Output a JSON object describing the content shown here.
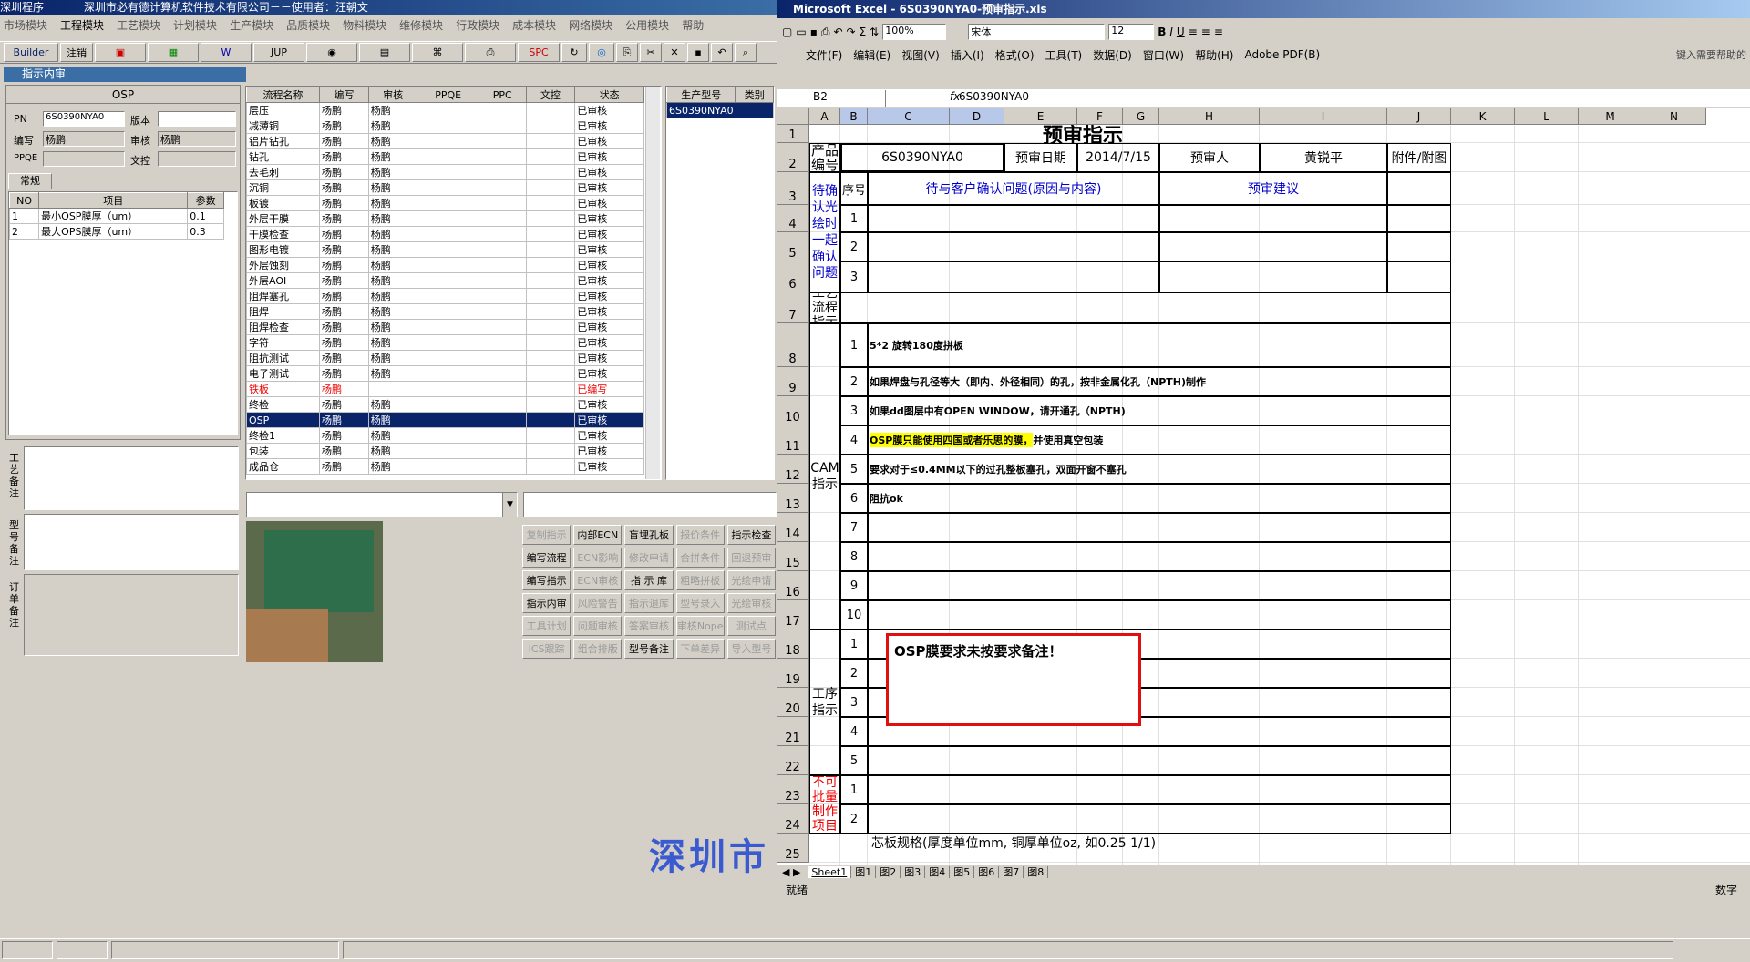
{
  "left": {
    "title": "深圳程序",
    "company": "深圳市必有德计算机软件技术有限公司－－使用者：汪朝文",
    "menu": [
      "市场模块",
      "工程模块",
      "工艺模块",
      "计划模块",
      "生产模块",
      "品质模块",
      "物料模块",
      "维修模块",
      "行政模块",
      "成本模块",
      "网络模块",
      "公用模块",
      "帮助"
    ],
    "toolbar": [
      "Builder",
      "注销",
      "JUP",
      "SPC"
    ],
    "subtitle": "指示内审",
    "form": {
      "header": "OSP",
      "pn_label": "PN",
      "pn": "6S0390NYA0",
      "ver_label": "版本",
      "writer_label": "编写",
      "writer": "杨鹏",
      "checker_label": "审核",
      "checker": "杨鹏",
      "ppqe_label": "PPQE",
      "doc_label": "文控",
      "tab": "常规"
    },
    "params": {
      "headers": [
        "NO",
        "项目",
        "参数"
      ],
      "rows": [
        [
          "1",
          "最小OSP膜厚（um）",
          "0.1"
        ],
        [
          "2",
          "最大OPS膜厚（um）",
          "0.3"
        ]
      ]
    },
    "side_labels": [
      "工艺备注",
      "型号备注",
      "订单备注"
    ],
    "flow": {
      "headers": [
        "流程名称",
        "编写",
        "审核",
        "PPQE",
        "PPC",
        "文控",
        "状态"
      ],
      "rows": [
        [
          "层压",
          "杨鹏",
          "杨鹏",
          "",
          "",
          "",
          "已审核"
        ],
        [
          "减薄铜",
          "杨鹏",
          "杨鹏",
          "",
          "",
          "",
          "已审核"
        ],
        [
          "铝片钻孔",
          "杨鹏",
          "杨鹏",
          "",
          "",
          "",
          "已审核"
        ],
        [
          "钻孔",
          "杨鹏",
          "杨鹏",
          "",
          "",
          "",
          "已审核"
        ],
        [
          "去毛刺",
          "杨鹏",
          "杨鹏",
          "",
          "",
          "",
          "已审核"
        ],
        [
          "沉铜",
          "杨鹏",
          "杨鹏",
          "",
          "",
          "",
          "已审核"
        ],
        [
          "板镀",
          "杨鹏",
          "杨鹏",
          "",
          "",
          "",
          "已审核"
        ],
        [
          "外层干膜",
          "杨鹏",
          "杨鹏",
          "",
          "",
          "",
          "已审核"
        ],
        [
          "干膜检查",
          "杨鹏",
          "杨鹏",
          "",
          "",
          "",
          "已审核"
        ],
        [
          "图形电镀",
          "杨鹏",
          "杨鹏",
          "",
          "",
          "",
          "已审核"
        ],
        [
          "外层蚀刻",
          "杨鹏",
          "杨鹏",
          "",
          "",
          "",
          "已审核"
        ],
        [
          "外层AOI",
          "杨鹏",
          "杨鹏",
          "",
          "",
          "",
          "已审核"
        ],
        [
          "阻焊塞孔",
          "杨鹏",
          "杨鹏",
          "",
          "",
          "",
          "已审核"
        ],
        [
          "阻焊",
          "杨鹏",
          "杨鹏",
          "",
          "",
          "",
          "已审核"
        ],
        [
          "阻焊检查",
          "杨鹏",
          "杨鹏",
          "",
          "",
          "",
          "已审核"
        ],
        [
          "字符",
          "杨鹏",
          "杨鹏",
          "",
          "",
          "",
          "已审核"
        ],
        [
          "阻抗测试",
          "杨鹏",
          "杨鹏",
          "",
          "",
          "",
          "已审核"
        ],
        [
          "电子测试",
          "杨鹏",
          "杨鹏",
          "",
          "",
          "",
          "已审核"
        ],
        [
          "铁板",
          "杨鹏",
          "",
          "",
          "",
          "",
          "已编写"
        ],
        [
          "终检",
          "杨鹏",
          "杨鹏",
          "",
          "",
          "",
          "已审核"
        ],
        [
          "OSP",
          "杨鹏",
          "杨鹏",
          "",
          "",
          "",
          "已审核"
        ],
        [
          "终检1",
          "杨鹏",
          "杨鹏",
          "",
          "",
          "",
          "已审核"
        ],
        [
          "包装",
          "杨鹏",
          "杨鹏",
          "",
          "",
          "",
          "已审核"
        ],
        [
          "成品仓",
          "杨鹏",
          "杨鹏",
          "",
          "",
          "",
          "已审核"
        ]
      ]
    },
    "model": {
      "headers": [
        "生产型号",
        "类别"
      ],
      "value": "6S0390NYA0"
    },
    "buttons": [
      "复制指示",
      "内部ECN",
      "盲埋孔板",
      "报价条件",
      "指示检查",
      "编写流程",
      "ECN影响",
      "修改申请",
      "合拼条件",
      "回退预审",
      "编写指示",
      "ECN审核",
      "指 示 库",
      "粗略拼板",
      "光绘申请",
      "指示内审",
      "风险警告",
      "指示退库",
      "型号录入",
      "光绘审核",
      "工具计划",
      "问题审核",
      "答案审核",
      "审核Nope",
      "测试点",
      "ICS跟踪",
      "组合排版",
      "型号备注",
      "下单差异",
      "导入型号"
    ],
    "watermark": "深圳市"
  },
  "excel": {
    "title": "Microsoft Excel - 6S0390NYA0-预审指示.xls",
    "menu": [
      "文件(F)",
      "编辑(E)",
      "视图(V)",
      "插入(I)",
      "格式(O)",
      "工具(T)",
      "数据(D)",
      "窗口(W)",
      "帮助(H)",
      "Adobe PDF(B)"
    ],
    "help_hint": "键入需要帮助的",
    "zoom": "100%",
    "font": "宋体",
    "size": "12",
    "namebox": "B2",
    "formula": "6S0390NYA0",
    "cols": [
      "A",
      "B",
      "C",
      "D",
      "E",
      "F",
      "G",
      "H",
      "I",
      "J",
      "K",
      "L",
      "M",
      "N"
    ],
    "rows": [
      "1",
      "2",
      "3",
      "4",
      "5",
      "6",
      "7",
      "8",
      "9",
      "10",
      "11",
      "12",
      "13",
      "14",
      "15",
      "16",
      "17",
      "18",
      "19",
      "20",
      "21",
      "22",
      "23",
      "24",
      "25"
    ],
    "heading": "预审指示",
    "c_prod": "产品编号",
    "c_pn": "6S0390NYA0",
    "c_date_l": "预审日期",
    "c_date": "2014/7/15",
    "c_rev_l": "预审人",
    "c_rev": "黄锐平",
    "c_att": "附件/附图",
    "c_seq": "序号",
    "c_q": "待与客户确认问题(原因与内容)",
    "c_sug": "预审建议",
    "c_confirm": "待确认光绘时一起确认问题",
    "c_proc": "工艺流程指示",
    "c_cam": "CAM指示",
    "cam_items": [
      "5*2 旋转180度拼板",
      "如果焊盘与孔径等大（即内、外径相同）的孔，按非金属化孔（NPTH)制作",
      "如果dd图层中有OPEN WINDOW，请开通孔（NPTH)",
      "OSP膜只能使用四国或者乐思的膜，并使用真空包装",
      "要求对于≤0.4MM以下的过孔整板塞孔，双面开窗不塞孔",
      "阻抗ok",
      "",
      "",
      "",
      ""
    ],
    "cam_hl": "OSP膜只能使用四国或者乐思的膜，",
    "cam_rest": "并使用真空包装",
    "c_step": "工序指示",
    "c_forbid": "不可批量制作项目",
    "c_core": "芯板规格(厚度单位mm, 铜厚单位oz, 如0.25 1/1)",
    "comment": "OSP膜要求未按要求备注！",
    "sheets": [
      "Sheet1",
      "图1",
      "图2",
      "图3",
      "图4",
      "图5",
      "图6",
      "图7",
      "图8"
    ],
    "status": "就绪",
    "status_r": "数字"
  }
}
